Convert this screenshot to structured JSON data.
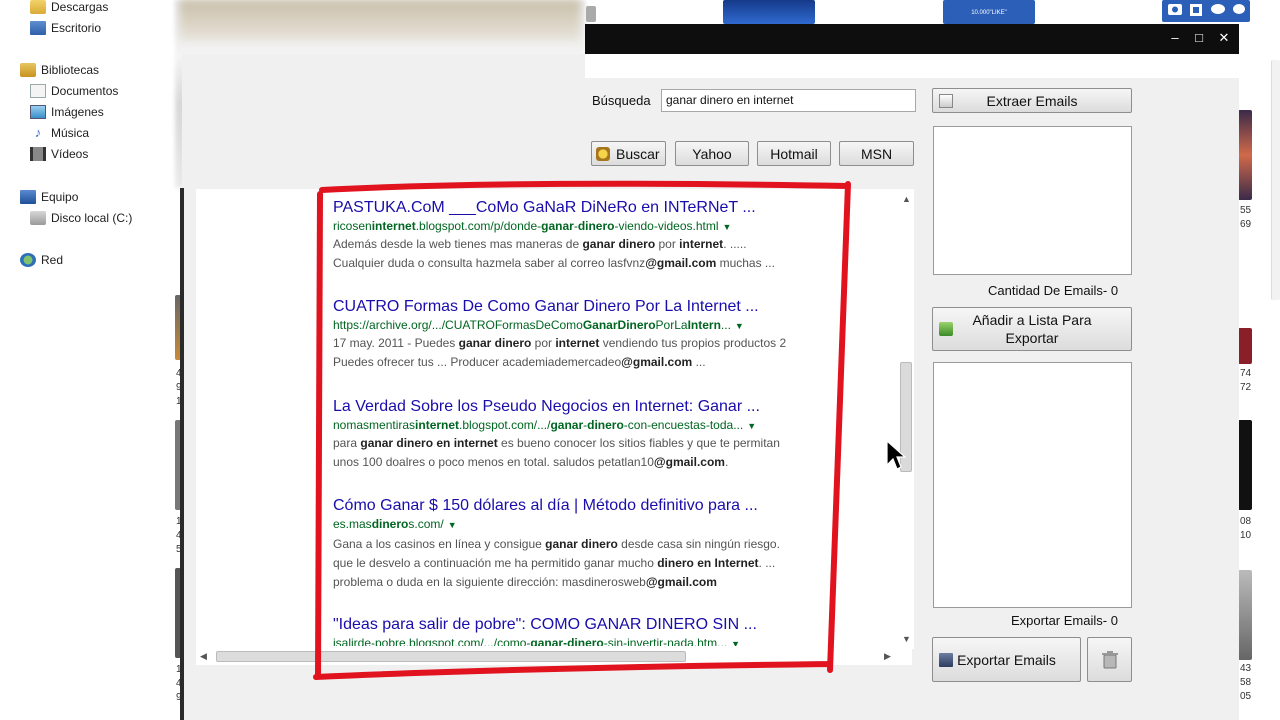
{
  "explorer": {
    "items": [
      {
        "label": "Descargas"
      },
      {
        "label": "Escritorio"
      },
      {
        "label": "Bibliotecas"
      },
      {
        "label": "Documentos"
      },
      {
        "label": "Imágenes"
      },
      {
        "label": "Música"
      },
      {
        "label": "Vídeos"
      },
      {
        "label": "Equipo"
      },
      {
        "label": "Disco local (C:)"
      },
      {
        "label": "Red"
      }
    ]
  },
  "background": {
    "thumb_text": "10.000\"LIKE\"",
    "right_numbers": [
      "55",
      "69",
      "74",
      "72",
      "08",
      "10",
      "43",
      "58",
      "05"
    ],
    "left_numbers": [
      "4",
      "9",
      "1",
      "1",
      "4",
      "5",
      "1",
      "4",
      "9"
    ]
  },
  "form": {
    "search_label": "Búsqueda",
    "search_value": "ganar dinero en internet",
    "buttons": {
      "buscar": "Buscar",
      "yahoo": "Yahoo",
      "hotmail": "Hotmail",
      "msn": "MSN",
      "extraer": "Extraer Emails",
      "anadir_line1": "Añadir a Lista Para",
      "anadir_line2": "Exportar",
      "exportar": "Exportar Emails"
    },
    "cantidad_label": "Cantidad De Emails- 0",
    "exportar_count_label": "Exportar Emails- 0"
  },
  "results": [
    {
      "title": "PASTUKA.CoM ___CoMo GaNaR DiNeRo en INTeRNeT ...",
      "url_parts": [
        [
          "ricosen",
          false
        ],
        [
          "internet",
          true
        ],
        [
          ".blogspot.com/p/donde-",
          false
        ],
        [
          "ganar",
          true
        ],
        [
          "-",
          false
        ],
        [
          "dinero",
          true
        ],
        [
          "-viendo-videos.html",
          false
        ]
      ],
      "snippet1": [
        [
          "Además desde la web tienes mas maneras de ",
          false
        ],
        [
          "ganar dinero",
          true
        ],
        [
          " por ",
          false
        ],
        [
          "internet",
          true
        ],
        [
          ". .....",
          false
        ]
      ],
      "snippet2": [
        [
          "Cualquier duda o consulta hazmela saber al correo lasfvnz",
          false
        ],
        [
          "@gmail.com",
          true
        ],
        [
          " muchas ...",
          false
        ]
      ]
    },
    {
      "title": "CUATRO Formas De Como Ganar Dinero Por La Internet ...",
      "url_parts": [
        [
          "https://archive.org/.../CUATROFormasDeComo",
          false
        ],
        [
          "GanarDinero",
          true
        ],
        [
          "PorLa",
          false
        ],
        [
          "Intern",
          true
        ],
        [
          "...",
          false
        ]
      ],
      "snippet1": [
        [
          "17 may. 2011 - Puedes ",
          false
        ],
        [
          "ganar dinero",
          true
        ],
        [
          " por ",
          false
        ],
        [
          "internet",
          true
        ],
        [
          " vendiendo tus propios productos 2",
          false
        ]
      ],
      "snippet2": [
        [
          "Puedes ofrecer tus ... Producer academiademercadeo",
          false
        ],
        [
          "@gmail.com",
          true
        ],
        [
          " ...",
          false
        ]
      ]
    },
    {
      "title": "La Verdad Sobre los Pseudo Negocios en Internet: Ganar ...",
      "url_parts": [
        [
          "nomasmentiras",
          false
        ],
        [
          "internet",
          true
        ],
        [
          ".blogspot.com/.../",
          false
        ],
        [
          "ganar",
          true
        ],
        [
          "-",
          false
        ],
        [
          "dinero",
          true
        ],
        [
          "-con-encuestas-toda...",
          false
        ]
      ],
      "snippet1": [
        [
          "para ",
          false
        ],
        [
          "ganar dinero en internet",
          true
        ],
        [
          " es bueno conocer los sitios fiables y que te permitan",
          false
        ]
      ],
      "snippet2": [
        [
          "unos 100 doalres o poco menos en total. saludos petatlan10",
          false
        ],
        [
          "@gmail.com",
          true
        ],
        [
          ".",
          false
        ]
      ]
    },
    {
      "title": "Cómo Ganar $ 150 dólares al día | Método definitivo para ...",
      "url_parts": [
        [
          "es.mas",
          false
        ],
        [
          "dinero",
          true
        ],
        [
          "s.com/",
          false
        ]
      ],
      "snippet1": [
        [
          "Gana a los casinos en línea y consigue ",
          false
        ],
        [
          "ganar dinero",
          true
        ],
        [
          " desde casa sin ningún riesgo.",
          false
        ]
      ],
      "snippet2": [
        [
          "que le desvelo a continuación me ha permitido ganar mucho ",
          false
        ],
        [
          "dinero en Internet",
          true
        ],
        [
          ". ...",
          false
        ]
      ],
      "snippet3": [
        [
          "problema o duda en la siguiente dirección: masdinerosweb",
          false
        ],
        [
          "@gmail.com",
          true
        ]
      ]
    },
    {
      "title": "\"Ideas para salir de pobre\": COMO GANAR DINERO SIN ...",
      "url_parts": [
        [
          "isalirde-pobre.blogspot.com/.../como-",
          false
        ],
        [
          "ganar-dinero",
          true
        ],
        [
          "-sin-invertir-nada.htm...",
          false
        ]
      ]
    }
  ],
  "colors": {
    "title": "#1a0dab",
    "url": "#006621",
    "annotation": "#e0131f"
  }
}
